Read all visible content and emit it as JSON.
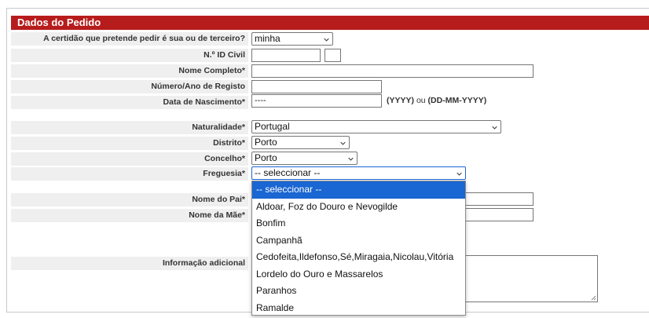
{
  "section_title": "Dados do Pedido",
  "fields": {
    "certidao": {
      "label": "A certidão que pretende pedir é sua ou de terceiro?",
      "value": "minha"
    },
    "id_civil": {
      "label": "N.º ID Civil",
      "value": "",
      "value2": ""
    },
    "nome_completo": {
      "label": "Nome Completo*",
      "value": ""
    },
    "numero_registo": {
      "label": "Número/Ano de Registo",
      "value": ""
    },
    "data_nascimento": {
      "label": "Data de Nascimento*",
      "value": "----",
      "hint_format1": "(YYYY)",
      "hint_ou": "ou",
      "hint_format2": "(DD-MM-YYYY)"
    },
    "naturalidade": {
      "label": "Naturalidade*",
      "value": "Portugal"
    },
    "distrito": {
      "label": "Distrito*",
      "value": "Porto"
    },
    "concelho": {
      "label": "Concelho*",
      "value": "Porto"
    },
    "freguesia": {
      "label": "Freguesia*",
      "value": "-- seleccionar --"
    },
    "nome_pai": {
      "label": "Nome do Pai*",
      "value": ""
    },
    "nome_mae": {
      "label": "Nome da Mãe*",
      "value": ""
    },
    "informacao_adicional": {
      "label": "Informação adicional",
      "value": ""
    }
  },
  "freguesia_dropdown": {
    "selected_index": 0,
    "options": [
      "-- seleccionar --",
      "Aldoar, Foz do Douro e Nevogilde",
      "Bonfim",
      "Campanhã",
      "Cedofeita,Ildefonso,Sé,Miragaia,Nicolau,Vitória",
      "Lordelo do Ouro e Massarelos",
      "Paranhos",
      "Ramalde"
    ]
  },
  "colors": {
    "header_bg": "#b71c1c",
    "label_bg": "#efefef",
    "selected_option": "#1a66d2"
  }
}
